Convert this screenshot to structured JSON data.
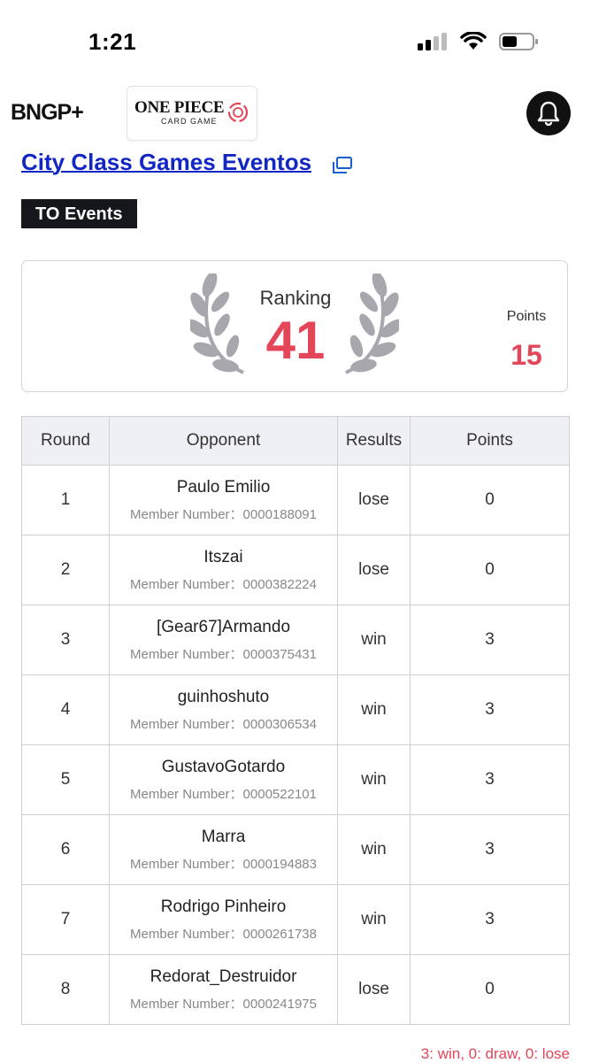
{
  "status_bar": {
    "time": "1:21"
  },
  "header": {
    "brand_logo": "BNGP+",
    "game_logo_title": "ONE PIECE",
    "game_logo_subtitle": "CARD GAME",
    "notification_icon": "bell-icon"
  },
  "event": {
    "title": "City Class Games Eventos",
    "badge": "TO Events"
  },
  "ranking": {
    "label": "Ranking",
    "value": "41",
    "points_label": "Points",
    "points_value": "15"
  },
  "table": {
    "headers": [
      "Round",
      "Opponent",
      "Results",
      "Points"
    ],
    "member_prefix": "Member Number：",
    "rows": [
      {
        "round": "1",
        "opponent": "Paulo Emilio",
        "member": "Member Number：0000188091",
        "result": "lose",
        "points": "0"
      },
      {
        "round": "2",
        "opponent": "Itszai",
        "member": "Member Number：0000382224",
        "result": "lose",
        "points": "0"
      },
      {
        "round": "3",
        "opponent": "[Gear67]Armando",
        "member": "Member Number：0000375431",
        "result": "win",
        "points": "3"
      },
      {
        "round": "4",
        "opponent": "guinhoshuto",
        "member": "Member Number：0000306534",
        "result": "win",
        "points": "3"
      },
      {
        "round": "5",
        "opponent": "GustavoGotardo",
        "member": "Member Number：0000522101",
        "result": "win",
        "points": "3"
      },
      {
        "round": "6",
        "opponent": "Marra",
        "member": "Member Number：0000194883",
        "result": "win",
        "points": "3"
      },
      {
        "round": "7",
        "opponent": "Rodrigo Pinheiro",
        "member": "Member Number：0000261738",
        "result": "win",
        "points": "3"
      },
      {
        "round": "8",
        "opponent": "Redorat_Destruidor",
        "member": "Member Number：0000241975",
        "result": "lose",
        "points": "0"
      }
    ]
  },
  "legend": "3: win, 0: draw, 0: lose",
  "colors": {
    "accent": "#e34659",
    "link": "#1226c4",
    "header_bg": "#efeff6"
  }
}
